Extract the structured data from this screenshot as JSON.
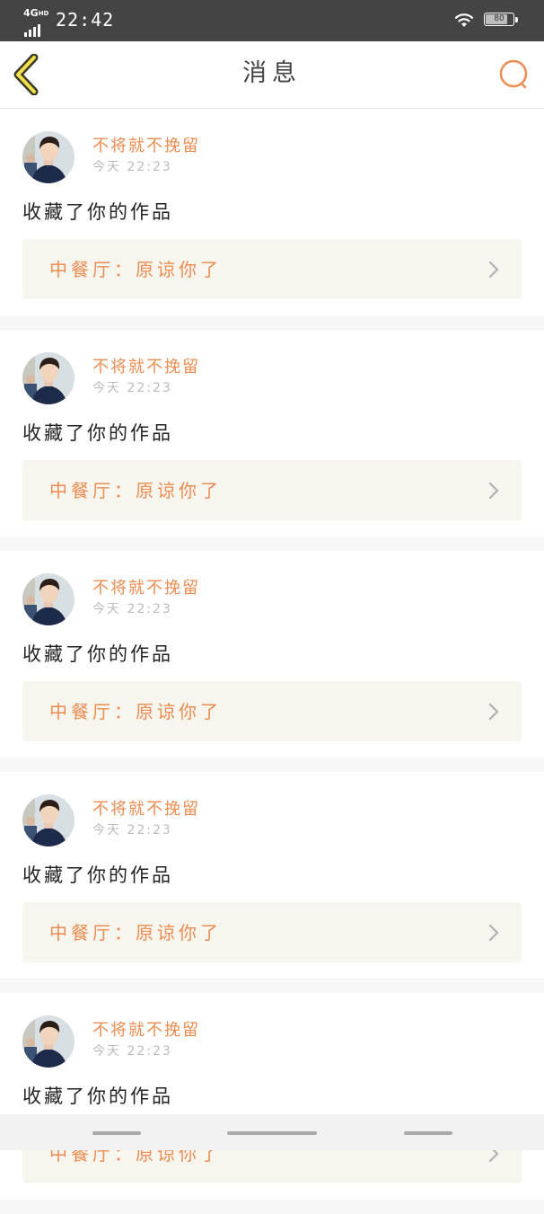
{
  "status_bar": {
    "network": "4G",
    "network_sup": "HD",
    "time": "22:42",
    "battery": "80",
    "icons": [
      "signal-icon",
      "wifi-icon",
      "battery-icon"
    ]
  },
  "nav": {
    "title": "消息",
    "back_icon": "chevron-left-icon",
    "search_icon": "search-icon"
  },
  "messages": [
    {
      "username": "不将就不挽留",
      "time": "今天 22:23",
      "action": "收藏了你的作品",
      "work": "中餐厅：原谅你了"
    },
    {
      "username": "不将就不挽留",
      "time": "今天 22:23",
      "action": "收藏了你的作品",
      "work": "中餐厅：原谅你了"
    },
    {
      "username": "不将就不挽留",
      "time": "今天 22:23",
      "action": "收藏了你的作品",
      "work": "中餐厅：原谅你了"
    },
    {
      "username": "不将就不挽留",
      "time": "今天 22:23",
      "action": "收藏了你的作品",
      "work": "中餐厅：原谅你了"
    },
    {
      "username": "不将就不挽留",
      "time": "今天 22:23",
      "action": "收藏了你的作品",
      "work": "中餐厅：原谅你了"
    }
  ],
  "colors": {
    "accent": "#ec8c50",
    "back_icon_stroke": "#3a3a2a",
    "back_icon_fill": "#f4e04a",
    "card_link_bg": "#f6f5ee",
    "status_bar_bg": "#444444"
  }
}
